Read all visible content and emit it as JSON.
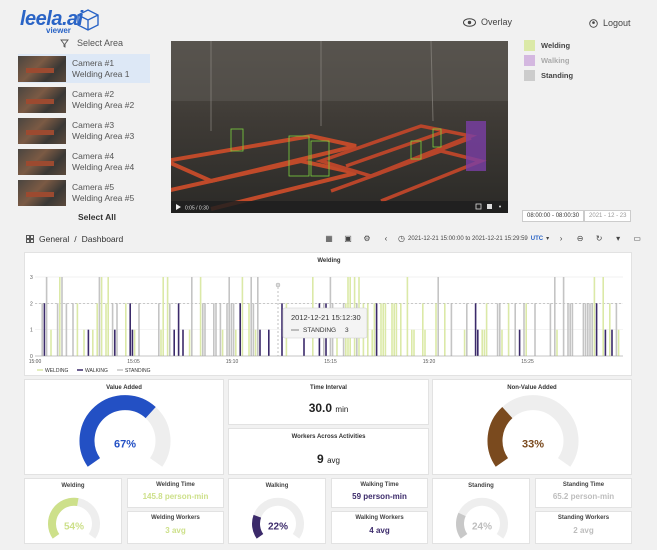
{
  "header": {
    "logo_text": "leela.ai",
    "logo_sub": "viewer",
    "overlay_label": "Overlay",
    "logout_label": "Logout"
  },
  "sidebar": {
    "select_area_label": "Select Area",
    "cameras": [
      {
        "name": "Camera #1",
        "area": "Welding Area 1"
      },
      {
        "name": "Camera #2",
        "area": "Welding Area #2"
      },
      {
        "name": "Camera #3",
        "area": "Welding Area #3"
      },
      {
        "name": "Camera #4",
        "area": "Welding Area #4"
      },
      {
        "name": "Camera #5",
        "area": "Welding Area #5"
      }
    ],
    "select_all_label": "Select All"
  },
  "legend": [
    {
      "label": "Welding",
      "color": "#dbe9a7"
    },
    {
      "label": "Walking",
      "color": "#d4b8e0"
    },
    {
      "label": "Standing",
      "color": "#cccccc"
    }
  ],
  "video": {
    "time_label": "0:05 / 0:30",
    "range_label": "08:00:00 - 08:00:30",
    "date_label": "2021 - 12 - 23"
  },
  "breadcrumb": {
    "section": "General",
    "page": "Dashboard"
  },
  "toolbar": {
    "range": "2021-12-21 15:00:00 to 2021-12-21 15:29:59",
    "tz": "UTC"
  },
  "chart_data": {
    "type": "bar",
    "title": "Welding",
    "ylim": [
      0,
      3
    ],
    "y_ticks": [
      "0",
      "1",
      "2",
      "3"
    ],
    "x_ticks": [
      "15:00",
      "15:05",
      "15:10",
      "15:15",
      "15:20",
      "15:25"
    ],
    "series": [
      {
        "name": "WELDING",
        "color": "#dbe9a7"
      },
      {
        "name": "WALKING",
        "color": "#3b2a6a"
      },
      {
        "name": "STANDING",
        "color": "#c4c4c4"
      }
    ],
    "tooltip": {
      "time": "2012-12-21 15:12:30",
      "series": "STANDING",
      "value": 3
    }
  },
  "metrics": {
    "value_added": {
      "title": "Value Added",
      "percent": 67,
      "label": "67%",
      "color": "#2350c4"
    },
    "time_interval": {
      "title": "Time Interval",
      "value": "30.0",
      "unit": "min"
    },
    "workers": {
      "title": "Workers Across Activities",
      "value": "9",
      "unit": "avg"
    },
    "non_value_added": {
      "title": "Non-Value Added",
      "percent": 33,
      "label": "33%",
      "color": "#7a4a1e"
    }
  },
  "activities": [
    {
      "title": "Welding",
      "percent": 54,
      "label": "54%",
      "color": "#cde08a",
      "time_title": "Welding Time",
      "time_value": "145.8",
      "time_unit": "person-min",
      "workers_title": "Welding Workers",
      "workers_value": "3",
      "workers_unit": "avg",
      "value_color": "#cde08a"
    },
    {
      "title": "Walking",
      "percent": 22,
      "label": "22%",
      "color": "#3b2a6a",
      "time_title": "Walking Time",
      "time_value": "59",
      "time_unit": "person-min",
      "workers_title": "Walking Workers",
      "workers_value": "4",
      "workers_unit": "avg",
      "value_color": "#3b2a6a"
    },
    {
      "title": "Standing",
      "percent": 24,
      "label": "24%",
      "color": "#c8c8c8",
      "time_title": "Standing Time",
      "time_value": "65.2",
      "time_unit": "person-min",
      "workers_title": "Standing Workers",
      "workers_value": "2",
      "workers_unit": "avg",
      "value_color": "#bdbdbd"
    }
  ]
}
